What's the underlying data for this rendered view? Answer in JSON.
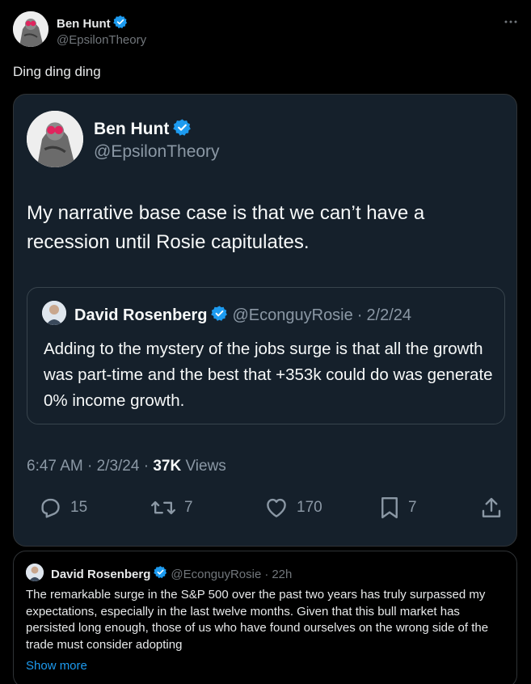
{
  "tweet": {
    "author_name": "Ben Hunt",
    "author_handle": "@EpsilonTheory",
    "more_icon": "more-icon",
    "text": "Ding ding ding"
  },
  "quoted_tweet": {
    "author_name": "Ben Hunt",
    "author_handle": "@EpsilonTheory",
    "text": "My narrative base case is that we can’t have a recession until Rosie capitulates.",
    "inner_quote": {
      "author_name": "David Rosenberg",
      "author_handle": "@EconguyRosie",
      "separator": "·",
      "date": "2/2/24",
      "text": "Adding to the mystery of the jobs surge is that all the growth was part-time and the best that +353k could do was generate 0% income growth."
    },
    "time": "6:47 AM",
    "date": "2/3/24",
    "views_count": "37K",
    "views_label": "Views",
    "stats": {
      "replies": "15",
      "reposts": "7",
      "likes": "170",
      "bookmarks": "7"
    }
  },
  "reply_tweet": {
    "author_name": "David Rosenberg",
    "author_handle": "@EconguyRosie",
    "separator": "·",
    "age": "22h",
    "text": "The remarkable surge in the S&P 500 over the past two years has truly surpassed my expectations, especially in the last twelve months. Given that this bull market has persisted long enough, those of us who have found ourselves on the wrong side of the trade must consider adopting",
    "show_more": "Show more"
  },
  "colors": {
    "background": "#000000",
    "card_background": "#15202b",
    "verified": "#1d9bf0",
    "link": "#1d9bf0",
    "secondary_text": "#71767b"
  }
}
